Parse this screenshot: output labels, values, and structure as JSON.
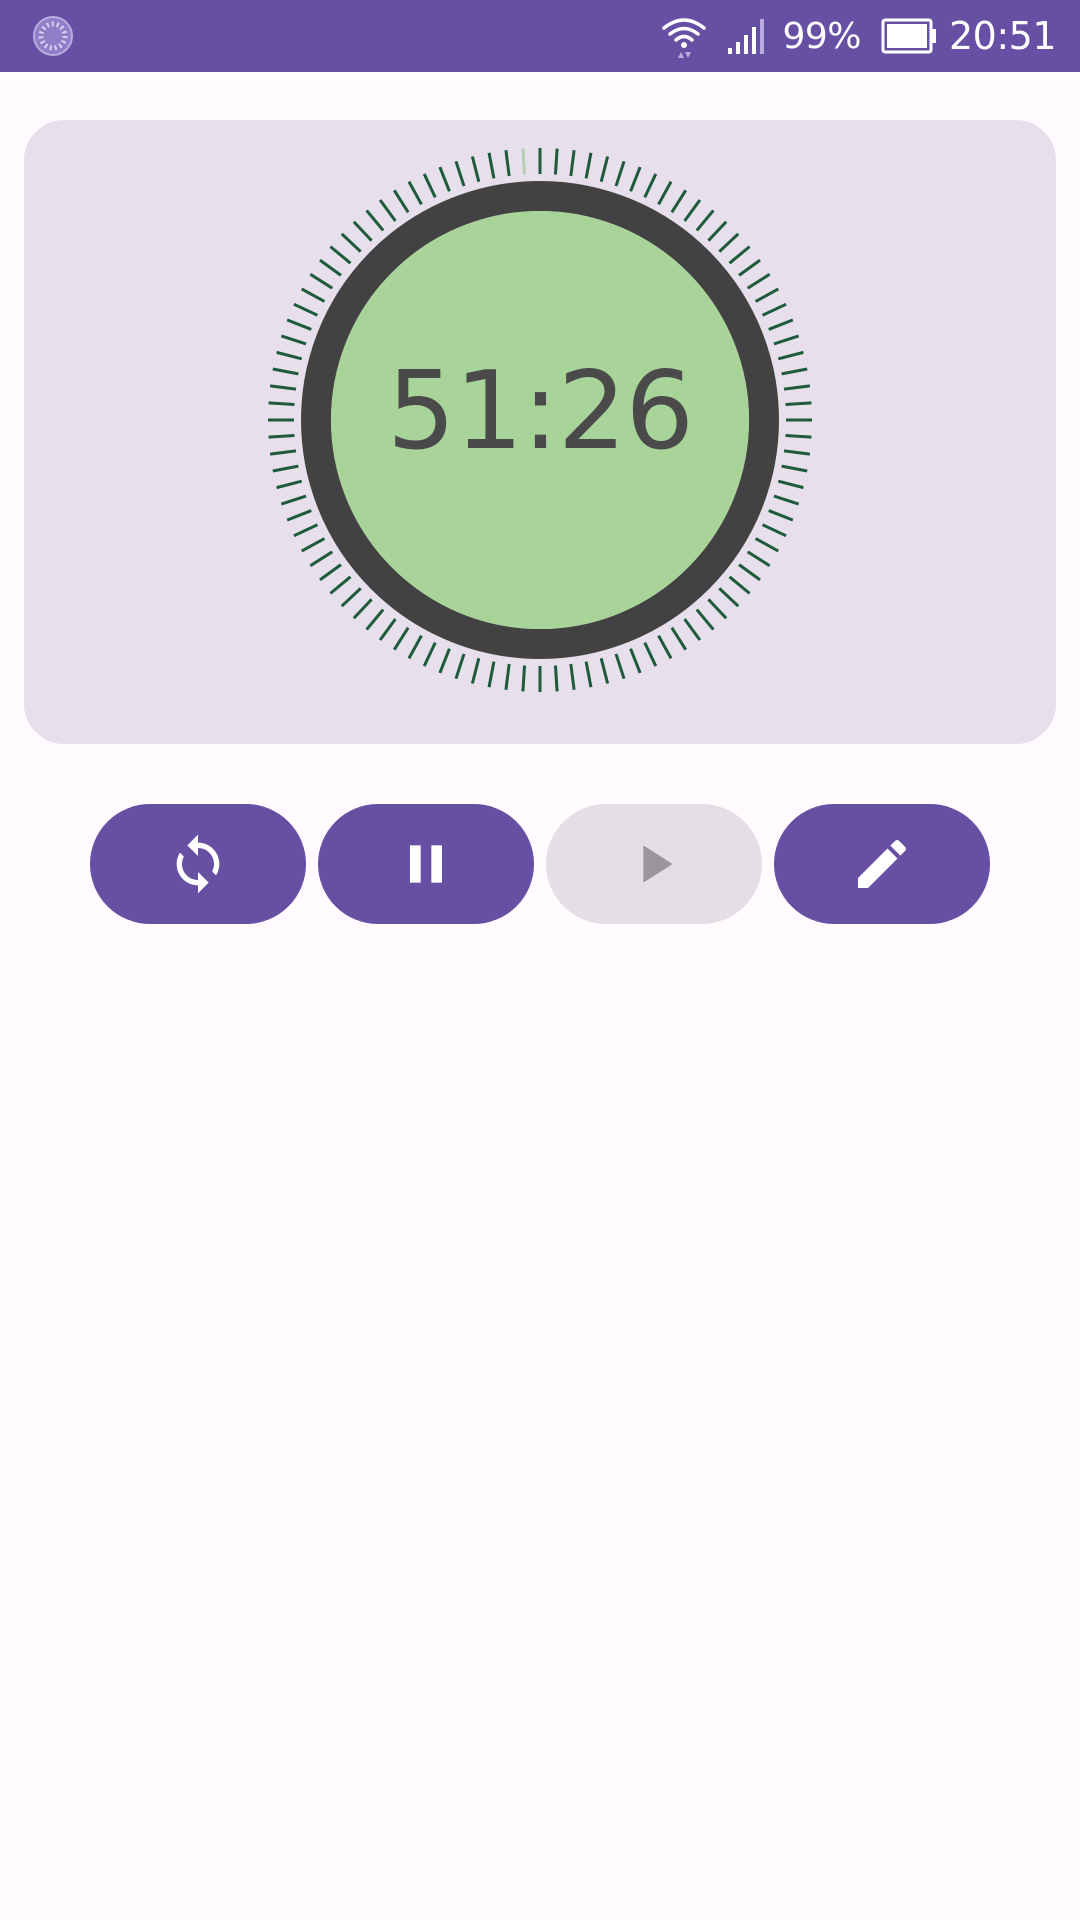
{
  "status_bar": {
    "battery_level": "99%",
    "clock": "20:51",
    "app_icon": "loading-spinner-icon",
    "icons": [
      "wifi-icon",
      "signal-icon",
      "battery-icon"
    ],
    "background_color": "#6750a4"
  },
  "timer": {
    "display": "51:26",
    "dial_color": "#a8d49a",
    "ring_color": "#424242",
    "tick_color": "#1e5a3c",
    "progress": 0.01
  },
  "controls": {
    "buttons": [
      {
        "name": "restart-button",
        "icon": "sync-icon",
        "enabled": true
      },
      {
        "name": "pause-button",
        "icon": "pause-icon",
        "enabled": true
      },
      {
        "name": "play-button",
        "icon": "play-icon",
        "enabled": false
      },
      {
        "name": "edit-button",
        "icon": "pencil-icon",
        "enabled": true
      }
    ],
    "accent_color": "#6750a4"
  }
}
